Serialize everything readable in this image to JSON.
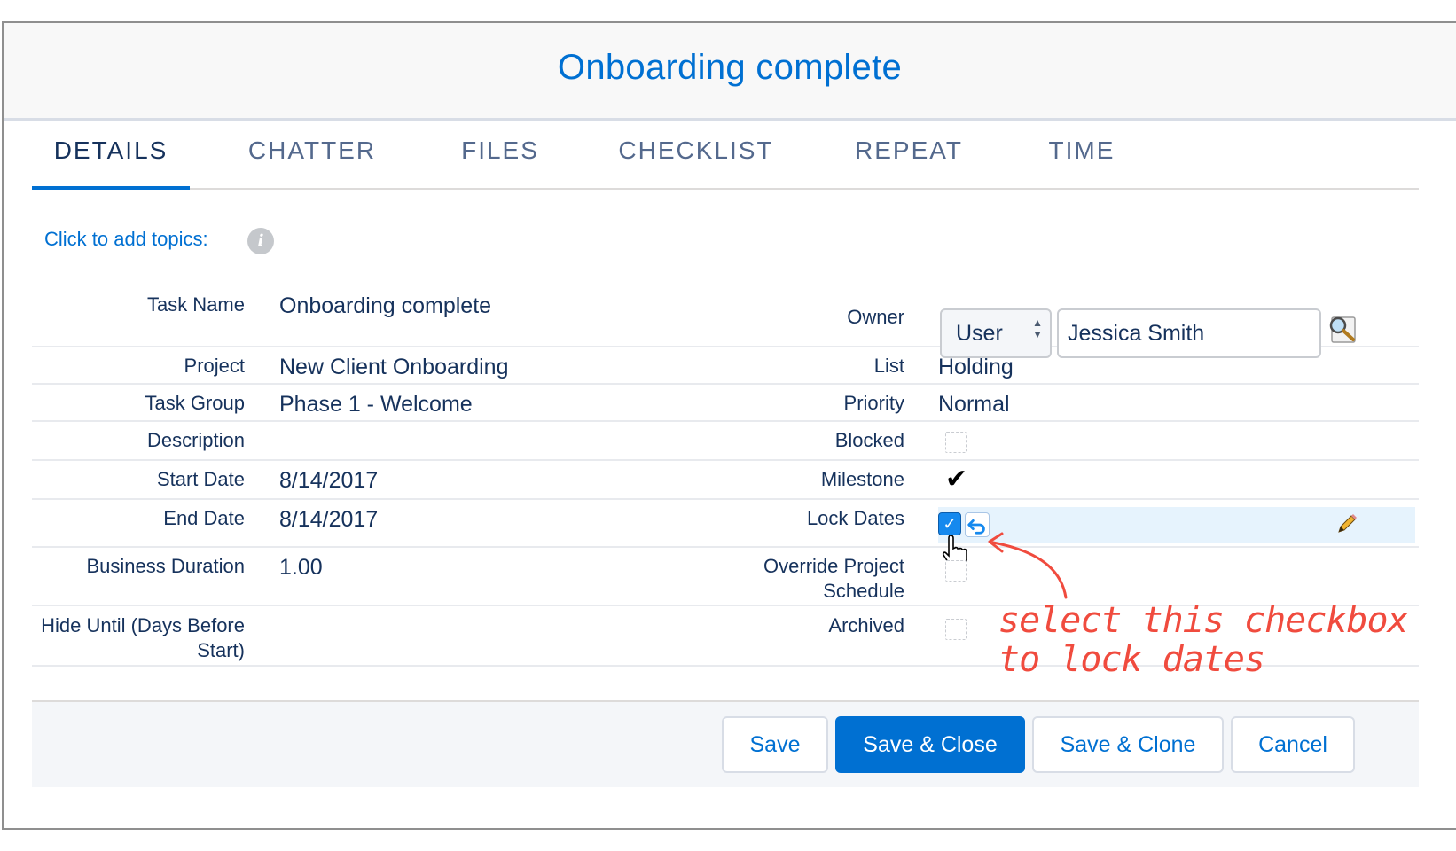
{
  "modal": {
    "title": "Onboarding complete"
  },
  "tabs": [
    {
      "label": "DETAILS",
      "active": true
    },
    {
      "label": "CHATTER"
    },
    {
      "label": "FILES"
    },
    {
      "label": "CHECKLIST"
    },
    {
      "label": "REPEAT"
    },
    {
      "label": "TIME"
    }
  ],
  "topics": {
    "label": "Click to add topics:",
    "info_icon": "info-icon"
  },
  "left_fields": {
    "task_name": {
      "label": "Task Name",
      "value": "Onboarding complete"
    },
    "project": {
      "label": "Project",
      "value": "New Client Onboarding"
    },
    "task_group": {
      "label": "Task Group",
      "value": "Phase 1 - Welcome"
    },
    "description": {
      "label": "Description",
      "value": ""
    },
    "start_date": {
      "label": "Start Date",
      "value": "8/14/2017"
    },
    "end_date": {
      "label": "End Date",
      "value": "8/14/2017"
    },
    "business_duration": {
      "label": "Business Duration",
      "value": "1.00"
    },
    "hide_until": {
      "label_line1": "Hide Until (Days Before",
      "label_line2": "Start)",
      "value": ""
    }
  },
  "right_fields": {
    "owner": {
      "label": "Owner",
      "type_value": "User",
      "name_value": "Jessica Smith"
    },
    "list": {
      "label": "List",
      "value": "Holding"
    },
    "priority": {
      "label": "Priority",
      "value": "Normal"
    },
    "blocked": {
      "label": "Blocked",
      "checked": false
    },
    "milestone": {
      "label": "Milestone",
      "checked": true
    },
    "lock_dates": {
      "label": "Lock Dates",
      "checked": true
    },
    "override_schedule": {
      "label_line1": "Override Project",
      "label_line2": "Schedule",
      "checked": false
    },
    "archived": {
      "label": "Archived",
      "checked": false
    }
  },
  "annotation": {
    "line1": "select this checkbox",
    "line2": "to lock dates",
    "color": "#f04b3e"
  },
  "footer": {
    "save": "Save",
    "save_close": "Save & Close",
    "save_clone": "Save & Clone",
    "cancel": "Cancel"
  },
  "colors": {
    "accent": "#0070d2",
    "text": "#16325c",
    "tab_inactive": "#54698d"
  }
}
